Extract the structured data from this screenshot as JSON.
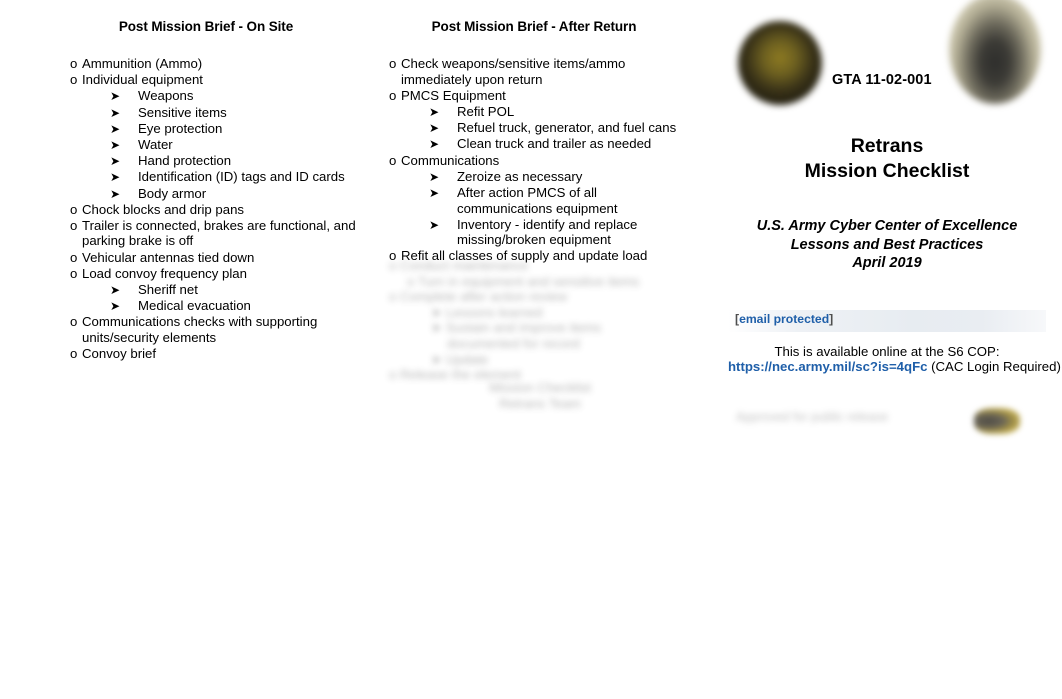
{
  "columns": [
    {
      "heading": "Post Mission Brief - On Site",
      "items": [
        {
          "text": "Ammunition  (Ammo)",
          "subitems": []
        },
        {
          "text": "Individual equipment",
          "subitems": [
            "Weapons",
            "Sensitive items",
            "Eye protection",
            "Water",
            "Hand protection",
            "Identification (ID) tags and ID cards",
            "Body armor"
          ]
        },
        {
          "text": "Chock blocks and drip pans",
          "subitems": []
        },
        {
          "text": "Trailer is connected, brakes are functional, and parking brake is off",
          "subitems": []
        },
        {
          "text": "Vehicular antennas tied down",
          "subitems": []
        },
        {
          "text": "Load convoy frequency plan",
          "subitems": [
            "Sheriff net",
            "Medical evacuation"
          ]
        },
        {
          "text": "Communications checks with supporting units/security elements",
          "subitems": []
        },
        {
          "text": "Convoy brief",
          "subitems": []
        }
      ]
    },
    {
      "heading": "Post Mission Brief - After Return",
      "items": [
        {
          "text": "Check weapons/sensitive items/ammo immediately upon return",
          "subitems": []
        },
        {
          "text": "PMCS Equipment",
          "subitems": [
            "Refit POL",
            "Refuel truck, generator, and fuel cans",
            "Clean truck and trailer as needed"
          ]
        },
        {
          "text": "Communications",
          "subitems": [
            "Zeroize as necessary",
            "After action PMCS of all communications equipment",
            "Inventory - identify and replace missing/broken equipment"
          ]
        },
        {
          "text": "Refit all classes of supply and update load",
          "subitems": []
        }
      ]
    }
  ],
  "obscured": {
    "note_a": "illegible-blurred-text-block",
    "note_b": "illegible-blurred-text-block",
    "footer_note": "illegible-blurred-footer-text"
  },
  "right_panel": {
    "gta_number": "GTA 11-02-001",
    "title_line1": "Retrans",
    "title_line2": "Mission Checklist",
    "subtitle_line1": "U.S. Army Cyber Center of Excellence",
    "subtitle_line2": "Lessons and Best Practices",
    "subtitle_line3": "April 2019",
    "email_bracket_open": "[",
    "email_text": "email protected",
    "email_bracket_close": "]",
    "cop_text": "This is available online at the S6 COP:",
    "url": "https://nec.army.mil/sc?is=4qFc",
    "url_suffix": " (CAC Login Required)",
    "seal_left": "army-seal-dark-gold",
    "seal_right": "army-seal-cream-emblem",
    "footer_emblem": "small-gold-emblem"
  },
  "colors": {
    "link_blue": "#1f5fa9",
    "bracket_gray": "#4e4e4e",
    "text_black": "#000000",
    "email_band": "#e7ecf1"
  },
  "glyphs": {
    "bullet_level1": "o",
    "bullet_level2": "➤"
  }
}
